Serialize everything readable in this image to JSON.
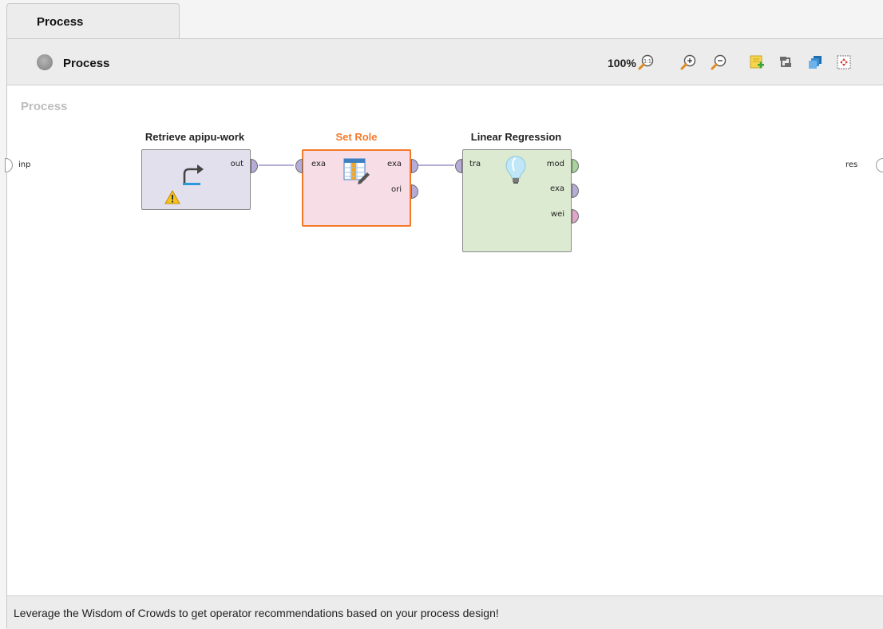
{
  "tabs": [
    {
      "label": "Process"
    }
  ],
  "toolbar": {
    "breadcrumb": "Process",
    "zoom": "100%"
  },
  "canvas": {
    "title": "Process",
    "left_port": "inp",
    "right_port": "res"
  },
  "operators": {
    "retrieve": {
      "title": "Retrieve apipu-work",
      "out_ports": [
        "out"
      ]
    },
    "set_role": {
      "title": "Set Role",
      "in_ports": [
        "exa"
      ],
      "out_ports": [
        "exa",
        "ori"
      ]
    },
    "linear_regression": {
      "title": "Linear Regression",
      "in_ports": [
        "tra"
      ],
      "out_ports": [
        "mod",
        "exa",
        "wei"
      ]
    }
  },
  "colors": {
    "retrieve_bg": "#e3e0ee",
    "set_role_bg": "#f7dde6",
    "set_role_border": "#f47a29",
    "set_role_title": "#f47a29",
    "regression_bg": "#dbead0",
    "port_example": "#b7acd9",
    "port_model": "#a7d49a",
    "port_weights": "#e2a5c9"
  },
  "footer": {
    "text": "Leverage the Wisdom of Crowds to get operator recommendations based on your process design!"
  }
}
